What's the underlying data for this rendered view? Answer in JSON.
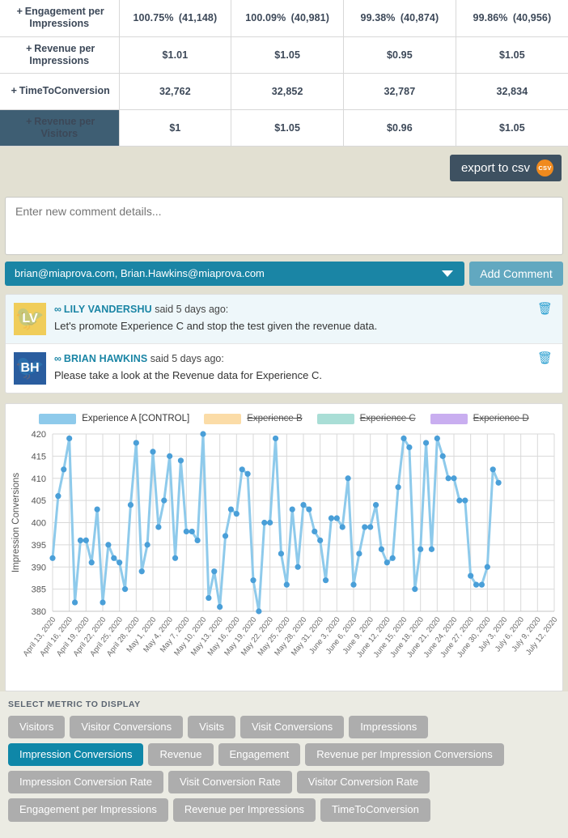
{
  "metrics_table": {
    "rows": [
      {
        "label": "Engagement per Impressions",
        "expander": "+",
        "active": false,
        "cells": [
          "100.75% (41,148)",
          "100.09% (40,981)",
          "99.38% (40,874)",
          "99.86% (40,956)"
        ]
      },
      {
        "label": "Revenue per Impressions",
        "expander": "+",
        "active": false,
        "cells": [
          "$1.01",
          "$1.05",
          "$0.95",
          "$1.05"
        ]
      },
      {
        "label": "TimeToConversion",
        "expander": "+",
        "active": false,
        "cells": [
          "32,762",
          "32,852",
          "32,787",
          "32,834"
        ]
      },
      {
        "label": "Revenue per Visitors",
        "expander": "+",
        "active": true,
        "cells": [
          "$1",
          "$1.05",
          "$0.96",
          "$1.05"
        ]
      }
    ]
  },
  "export": {
    "label": "export to csv",
    "badge": "CSV"
  },
  "composer": {
    "placeholder": "Enter new comment details...",
    "value": "",
    "recipients": "brian@miaprova.com, Brian.Hawkins@miaprova.com",
    "add_button": "Add Comment"
  },
  "comments": [
    {
      "initials": "LV",
      "author": "LILY VANDERSHU",
      "meta": "said 5 days ago:",
      "text": "Let's promote Experience C and stop the test given the revenue data.",
      "avatar_color": "#f0cd5a"
    },
    {
      "initials": "BH",
      "author": "BRIAN HAWKINS",
      "meta": "said 5 days ago:",
      "text": "Please take a look at the Revenue data for Experience C.",
      "avatar_color": "#2a5d9f"
    }
  ],
  "chart_data": {
    "type": "line",
    "title": "",
    "xlabel": "",
    "ylabel": "Impression Conversions",
    "ylim": [
      380,
      420
    ],
    "yticks": [
      380,
      385,
      390,
      395,
      400,
      405,
      410,
      415,
      420
    ],
    "grid": true,
    "legend_position": "top",
    "legend": [
      {
        "name": "Experience A [CONTROL]",
        "color": "#8ecaeb",
        "enabled": true
      },
      {
        "name": "Experience B",
        "color": "#fbdca7",
        "enabled": false
      },
      {
        "name": "Experience C",
        "color": "#a9ded6",
        "enabled": false
      },
      {
        "name": "Experience D",
        "color": "#c9aef0",
        "enabled": false
      }
    ],
    "xticks": [
      "April 13, 2020",
      "April 16, 2020",
      "April 19, 2020",
      "April 22, 2020",
      "April 25, 2020",
      "April 28, 2020",
      "May 1, 2020",
      "May 4, 2020",
      "May 7, 2020",
      "May 10, 2020",
      "May 13, 2020",
      "May 16, 2020",
      "May 19, 2020",
      "May 22, 2020",
      "May 25, 2020",
      "May 28, 2020",
      "May 31, 2020",
      "June 3, 2020",
      "June 6, 2020",
      "June 9, 2020",
      "June 12, 2020",
      "June 15, 2020",
      "June 18, 2020",
      "June 21, 2020",
      "June 24, 2020",
      "June 27, 2020",
      "June 30, 2020",
      "July 3, 2020",
      "July 6, 2020",
      "July 9, 2020",
      "July 12, 2020"
    ],
    "series": [
      {
        "name": "Experience A [CONTROL]",
        "color": "#5aa9dd",
        "values": [
          392,
          406,
          412,
          419,
          382,
          396,
          396,
          391,
          403,
          382,
          395,
          392,
          391,
          385,
          404,
          418,
          389,
          395,
          416,
          399,
          405,
          415,
          392,
          414,
          398,
          398,
          396,
          420,
          383,
          389,
          381,
          397,
          403,
          402,
          412,
          411,
          387,
          380,
          400,
          400,
          419,
          393,
          386,
          403,
          390,
          404,
          403,
          398,
          396,
          387,
          401,
          401,
          399,
          410,
          386,
          393,
          399,
          399,
          404,
          394,
          391,
          392,
          408,
          419,
          417,
          385,
          394,
          418,
          394,
          419,
          415,
          410,
          410,
          405,
          405,
          388,
          386,
          386,
          390,
          412,
          409
        ]
      }
    ]
  },
  "metric_selector": {
    "title": "SELECT METRIC TO DISPLAY",
    "rows": [
      [
        "Visitors",
        "Visitor Conversions",
        "Visits",
        "Visit Conversions",
        "Impressions"
      ],
      [
        "Impression Conversions",
        "Revenue",
        "Engagement",
        "Revenue per Impression Conversions"
      ],
      [
        "Impression Conversion Rate",
        "Visit Conversion Rate",
        "Visitor Conversion Rate"
      ],
      [
        "Engagement per Impressions",
        "Revenue per Impressions",
        "TimeToConversion"
      ]
    ],
    "selected": "Impression Conversions"
  },
  "colors": {
    "accent": "#0f87a8",
    "header_active": "#3e5e73",
    "header_inactive": "#8e9a8e",
    "page_bg": "#e2e0d2"
  }
}
